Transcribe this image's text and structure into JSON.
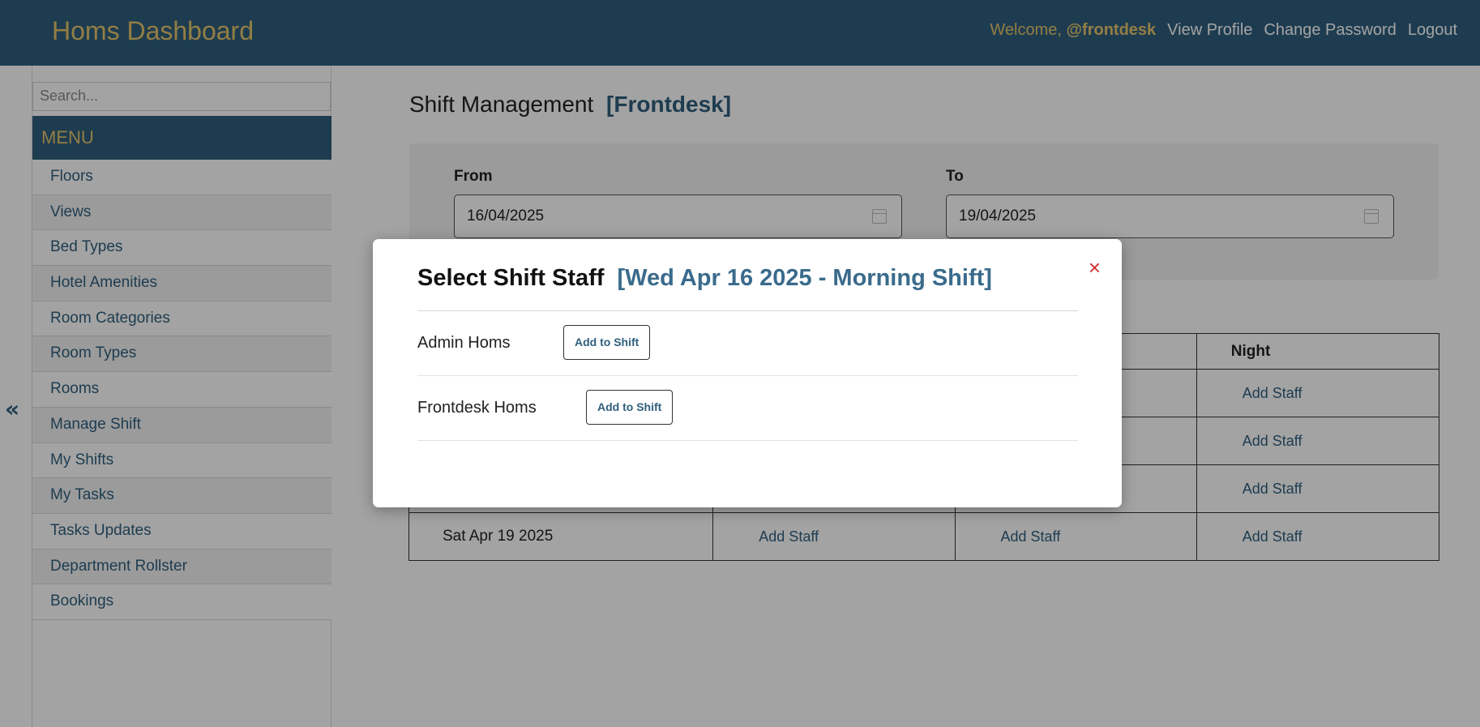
{
  "header": {
    "brand": "Homs Dashboard",
    "welcome_prefix": "Welcome,",
    "username": "@frontdesk",
    "nav": [
      "View Profile",
      "Change Password",
      "Logout"
    ]
  },
  "sidebar": {
    "search_placeholder": "Search...",
    "menu_title": "MENU",
    "items": [
      {
        "label": "Floors"
      },
      {
        "label": "Views"
      },
      {
        "label": "Bed Types"
      },
      {
        "label": "Hotel Amenities"
      },
      {
        "label": "Room Categories"
      },
      {
        "label": "Room Types"
      },
      {
        "label": "Rooms"
      },
      {
        "label": "Manage Shift"
      },
      {
        "label": "My Shifts"
      },
      {
        "label": "My Tasks"
      },
      {
        "label": "Tasks Updates"
      },
      {
        "label": "Department Rollster"
      },
      {
        "label": "Bookings"
      }
    ],
    "collapse_glyph": "«"
  },
  "main": {
    "title": "Shift Management",
    "role": "[Frontdesk]",
    "filters": {
      "from_label": "From",
      "from_value": "16/04/2025",
      "to_label": "To",
      "to_value": "19/04/2025"
    },
    "table": {
      "headers": [
        "",
        "",
        "",
        "Night"
      ],
      "rows": [
        {
          "date": "",
          "cells": [
            "",
            "",
            "Add Staff"
          ]
        },
        {
          "date": "",
          "cells": [
            "",
            "",
            "Add Staff"
          ]
        },
        {
          "date": "",
          "cells": [
            "",
            "",
            "Add Staff"
          ]
        },
        {
          "date": "Sat Apr 19 2025",
          "cells": [
            "Add Staff",
            "Add Staff",
            "Add Staff"
          ]
        }
      ]
    }
  },
  "modal": {
    "title": "Select Shift Staff",
    "subtitle": "[Wed Apr 16 2025 - Morning Shift]",
    "close_glyph": "×",
    "staff": [
      {
        "name": "Admin Homs",
        "button": "Add to Shift"
      },
      {
        "name": "Frontdesk Homs",
        "button": "Add to Shift"
      }
    ]
  }
}
